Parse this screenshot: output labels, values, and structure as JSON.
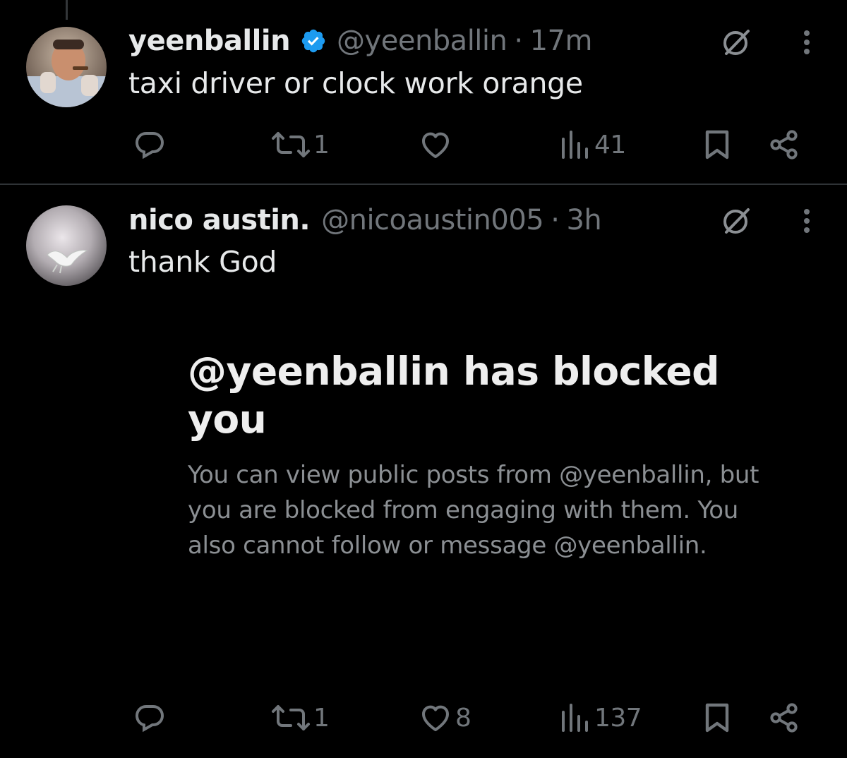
{
  "posts": [
    {
      "display_name": "yeenballin",
      "verified": true,
      "handle": "@yeenballin",
      "separator": "·",
      "time": "17m",
      "text": "taxi driver or clock work orange",
      "replies": "",
      "reposts": "1",
      "likes": "",
      "views": "41"
    },
    {
      "display_name": "nico austin.",
      "verified": false,
      "handle": "@nicoaustin005",
      "separator": "·",
      "time": "3h",
      "text": "thank God",
      "replies": "",
      "reposts": "1",
      "likes": "8",
      "views": "137"
    }
  ],
  "blocked_notice": {
    "title": "@yeenballin has blocked you",
    "description": "You can view public posts from @yeenballin, but you are blocked from engaging with them. You also cannot follow or message @yeenballin."
  },
  "icons": {
    "verified": "verified-badge-icon",
    "grok": "grok-icon",
    "more": "more-vertical-icon",
    "reply": "reply-icon",
    "repost": "repost-icon",
    "like": "heart-icon",
    "views": "views-icon",
    "bookmark": "bookmark-icon",
    "share": "share-icon"
  },
  "colors": {
    "background": "#000000",
    "primary_text": "#e7e9ea",
    "secondary_text": "#71767b",
    "verified_blue": "#1d9bf0",
    "divider": "#2f3336"
  }
}
